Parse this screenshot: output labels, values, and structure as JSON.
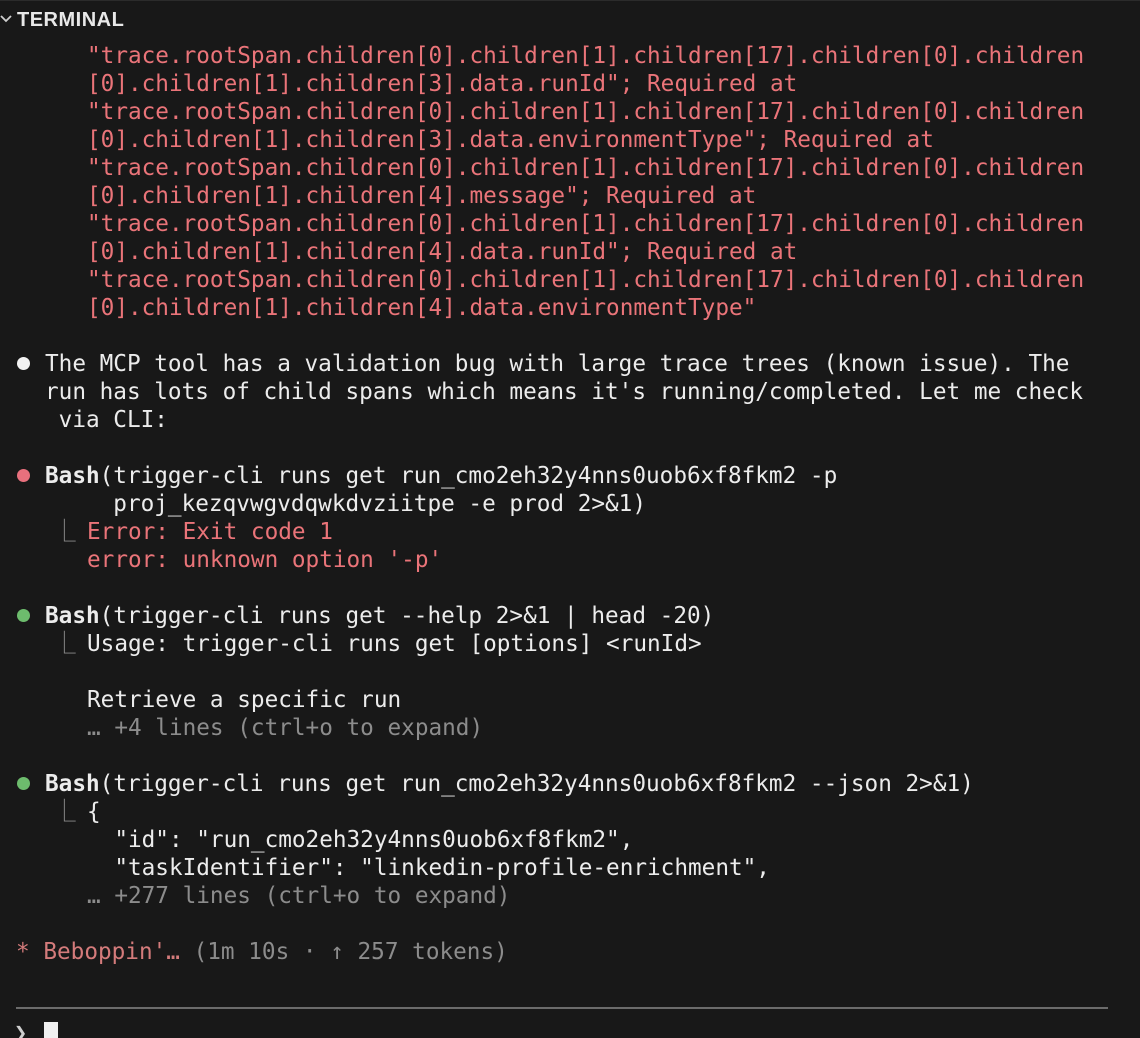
{
  "panel": {
    "title": "TERMINAL",
    "collapse_icon": "chevron-down-icon"
  },
  "error_continuation": [
    "\"trace.rootSpan.children[0].children[1].children[17].children[0].children",
    "[0].children[1].children[3].data.runId\"; Required at",
    "\"trace.rootSpan.children[0].children[1].children[17].children[0].children",
    "[0].children[1].children[3].data.environmentType\"; Required at",
    "\"trace.rootSpan.children[0].children[1].children[17].children[0].children",
    "[0].children[1].children[4].message\"; Required at",
    "\"trace.rootSpan.children[0].children[1].children[17].children[0].children",
    "[0].children[1].children[4].data.runId\"; Required at",
    "\"trace.rootSpan.children[0].children[1].children[17].children[0].children",
    "[0].children[1].children[4].data.environmentType\""
  ],
  "assistant_message": [
    "The MCP tool has a validation bug with large trace trees (known issue). The",
    "run has lots of child spans which means it's running/completed. Let me check",
    " via CLI:"
  ],
  "tool_calls": [
    {
      "status": "error",
      "name": "Bash",
      "command_lines": [
        "(trigger-cli runs get run_cmo2eh32y4nns0uob6xf8fkm2 -p",
        "     proj_kezqvwgvdqwkdvziitpe -e prod 2>&1)"
      ],
      "output_lines": [
        "Error: Exit code 1",
        "error: unknown option '-p'"
      ]
    },
    {
      "status": "success",
      "name": "Bash",
      "command_lines": [
        "(trigger-cli runs get --help 2>&1 | head -20)"
      ],
      "output_lines": [
        "Usage: trigger-cli runs get [options] <runId>",
        "",
        "Retrieve a specific run"
      ],
      "more": "… +4 lines (ctrl+o to expand)"
    },
    {
      "status": "success",
      "name": "Bash",
      "command_lines": [
        "(trigger-cli runs get run_cmo2eh32y4nns0uob6xf8fkm2 --json 2>&1)"
      ],
      "output_lines": [
        "{",
        "  \"id\": \"run_cmo2eh32y4nns0uob6xf8fkm2\",",
        "  \"taskIdentifier\": \"linkedin-profile-enrichment\","
      ],
      "more": "… +277 lines (ctrl+o to expand)"
    }
  ],
  "status_line": {
    "spinner": "*",
    "word": "Beboppin'…",
    "details": "(1m 10s · ↑ 257 tokens)"
  },
  "prompt": {
    "symbol": "❯"
  },
  "colors": {
    "background": "#181818",
    "error_text": "#ea7479",
    "dim_text": "#8c8c8c",
    "success_dot": "#6dbc6d",
    "error_dot": "#e8707d"
  }
}
